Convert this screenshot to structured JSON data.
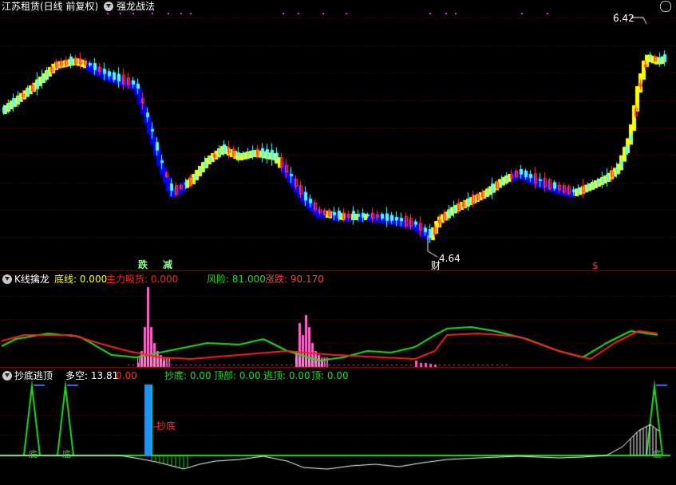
{
  "main_panel": {
    "stock_title": "江苏租赁(日线 前复权)",
    "indicator_name": "强龙战法",
    "high_label": "6.42",
    "low_label": "4.64",
    "marker_die": "跌",
    "marker_jian": "减",
    "marker_cai": "财",
    "marker_s": "$"
  },
  "panel2": {
    "name": "K线擒龙",
    "items": [
      {
        "label": "底线: 0.000",
        "color": "#ffff00"
      },
      {
        "label": "主力吸货: 0.000",
        "color": "#ff2020"
      },
      {
        "label": "风险: 81.000",
        "color": "#22dd22"
      },
      {
        "label": "涨跌: 90.170",
        "color": "#ff4040"
      }
    ]
  },
  "panel3": {
    "name": "抄底逃顶",
    "duokong": "多空: 13.81",
    "value2": "0.00",
    "items": [
      {
        "label": "抄底: 0.00",
        "color": "#22dd22"
      },
      {
        "label": "顶部: 0.00",
        "color": "#22dd22"
      },
      {
        "label": "逃顶: 0.00",
        "color": "#22dd22"
      },
      {
        "label": "顶: 0.00",
        "color": "#22dd22"
      }
    ],
    "chaodi_label": "抄底",
    "di_label": "底",
    "top_tag": "0.00"
  },
  "colors": {
    "up": "#ff3b3b",
    "down": "#54ffff",
    "trend_yellow": "#ffff00",
    "trend_blue": "#0000ff",
    "grid": "#7a0000",
    "separator": "#b00000"
  }
}
